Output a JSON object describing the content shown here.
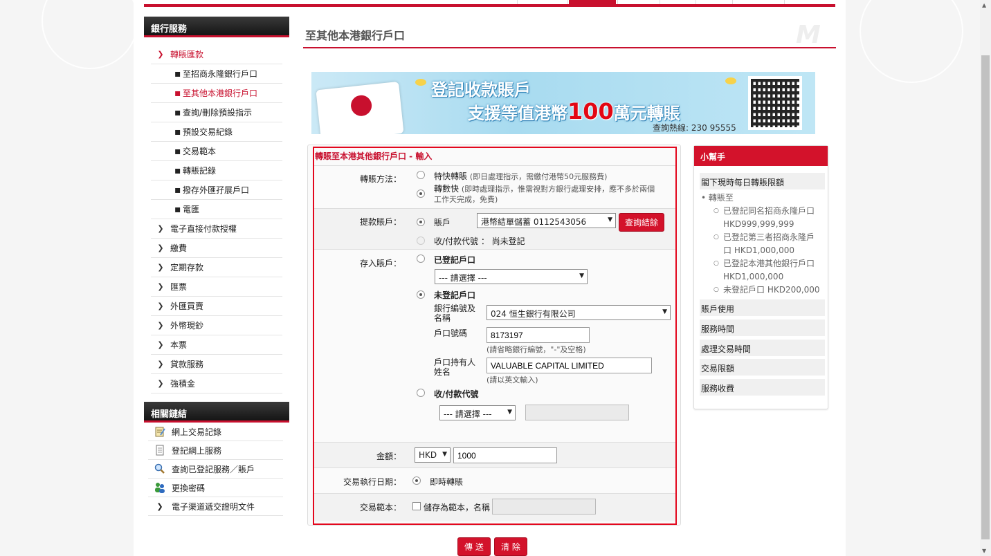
{
  "sidebar": {
    "header": "銀行服務",
    "menu": [
      {
        "label": "轉賬匯款"
      },
      {
        "label": "至招商永隆銀行戶口"
      },
      {
        "label": "至其他本港銀行戶口"
      },
      {
        "label": "查詢/刪除預設指示"
      },
      {
        "label": "預設交易紀錄"
      },
      {
        "label": "交易範本"
      },
      {
        "label": "轉賬記錄"
      },
      {
        "label": "撥存外匯孖展戶口"
      },
      {
        "label": "電匯"
      },
      {
        "label": "電子直接付款授權"
      },
      {
        "label": "繳費"
      },
      {
        "label": "定期存款"
      },
      {
        "label": "匯票"
      },
      {
        "label": "外匯買賣"
      },
      {
        "label": "外幣現鈔"
      },
      {
        "label": "本票"
      },
      {
        "label": "貸款服務"
      },
      {
        "label": "強積金"
      }
    ],
    "links_header": "相關鏈結",
    "links": [
      {
        "label": "網上交易記錄",
        "icon": "notepad-icon"
      },
      {
        "label": "登記網上服務",
        "icon": "document-icon"
      },
      {
        "label": "查詢已登記服務／賬戶",
        "icon": "magnifier-icon"
      },
      {
        "label": "更換密碼",
        "icon": "users-icon"
      },
      {
        "label": "電子渠道遞交證明文件",
        "icon": "chevron-right-icon"
      }
    ]
  },
  "page": {
    "title": "至其他本港銀行戶口"
  },
  "banner": {
    "line1": "登記收款賬戶",
    "line2_pre": "支援等值港幣",
    "line2_num": "100",
    "line2_post": "萬元轉賬",
    "hotline": "查詢熱線: 230 95555"
  },
  "form": {
    "title": "轉賬至本港其他銀行戶口 - 輸入",
    "method_label": "轉賬方法：",
    "method_opt1": "特快轉賬",
    "method_opt1_note": "(即日處理指示，需繳付港幣50元服務費)",
    "method_opt2": "轉數快",
    "method_opt2_note1": "(即時處理指示，惟需視對方銀行處理安排，應不多於兩個",
    "method_opt2_note2": "工作天完成，免費)",
    "debit_label": "提款賬戶：",
    "debit_opt1": "賬戶",
    "debit_account": "港幣結單儲蓄 0112543056",
    "balance_button": "查詢結餘",
    "debit_opt2": "收/付款代號 ： 尚未登記",
    "credit_label": "存入賬戶：",
    "registered": "已登記戶口",
    "registered_select": "--- 請選擇 ---",
    "unregistered": "未登記戶口",
    "bank_label1": "銀行編號及",
    "bank_label2": "名稱",
    "bank_value": "024 恒生銀行有限公司",
    "acct_label": "戶口號碼",
    "acct_value": "8173197",
    "acct_note": "(請省略銀行編號，\"-\"及空格)",
    "holder_label1": "戶口持有人",
    "holder_label2": "姓名",
    "holder_value": "VALUABLE CAPITAL LIMITED",
    "holder_note": "(請以英文輸入)",
    "proxy": "收/付款代號",
    "proxy_select": "--- 請選擇 ---",
    "amount_label": "金額：",
    "currency": "HKD",
    "amount": "1000",
    "date_label": "交易執行日期：",
    "date_value": "即時轉賬",
    "template_label": "交易範本：",
    "template_check": "儲存為範本，名稱"
  },
  "buttons": {
    "submit": "傳 送",
    "clear": "清 除"
  },
  "helper": {
    "title": "小幫手",
    "daily_limit": "閣下現時每日轉賬限額",
    "transfer_to": "轉賬至",
    "l1a": "已登記同名招商永隆戶口",
    "l1b": "HKD999,999,999",
    "l2a": "已登記第三者招商永隆戶",
    "l2b": "口 HKD1,000,000",
    "l3a": "已登記本港其他銀行戶口",
    "l3b": "HKD1,000,000",
    "l4": "未登記戶口 HKD200,000",
    "items": [
      "賬戶使用",
      "服務時間",
      "處理交易時間",
      "交易限額",
      "服務收費"
    ]
  },
  "colors": {
    "brand_red": "#c8102e",
    "highlight_red": "#e3071d"
  }
}
